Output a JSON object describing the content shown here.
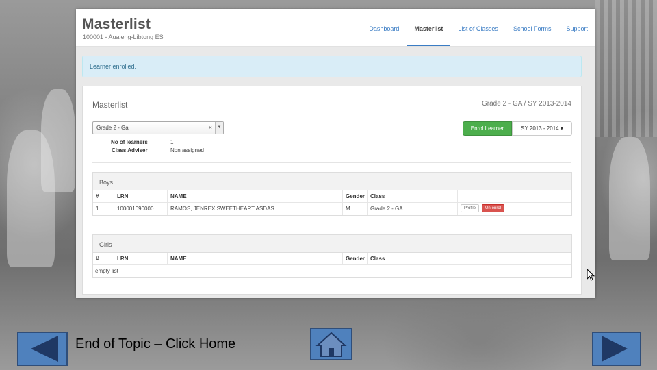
{
  "app": {
    "title": "Masterlist",
    "school": "100001 - Aualeng-Libtong ES"
  },
  "nav": [
    {
      "label": "Dashboard",
      "active": false
    },
    {
      "label": "Masterlist",
      "active": true
    },
    {
      "label": "List of Classes",
      "active": false
    },
    {
      "label": "School Forms",
      "active": false
    },
    {
      "label": "Support",
      "active": false
    }
  ],
  "alert": {
    "text": "Learner enrolled."
  },
  "panel": {
    "title": "Masterlist",
    "context": "Grade 2 - GA / SY 2013-2014",
    "class_select": "Grade 2 - Ga",
    "no_learners_label": "No of learners",
    "no_learners_value": "1",
    "adviser_label": "Class Adviser",
    "adviser_value": "Non assigned",
    "enrol_button": "Enrol Learner",
    "sy_button": "SY 2013 - 2014",
    "sy_caret": "▾"
  },
  "columns": [
    "#",
    "LRN",
    "NAME",
    "Gender",
    "Class"
  ],
  "boys": {
    "heading": "Boys",
    "rows": [
      {
        "num": "1",
        "lrn": "100001090000",
        "name": "RAMOS, JENREX SWEETHEART ASDAS",
        "gender": "M",
        "class": "Grade 2 - GA",
        "profile": "Profile",
        "unenrol": "Un-enrol"
      }
    ]
  },
  "girls": {
    "heading": "Girls",
    "empty": "empty list"
  },
  "footer": {
    "text": "End of Topic – Click Home"
  },
  "colors": {
    "accent": "#3a7cc4",
    "success": "#4cae4c",
    "danger": "#d9534f",
    "nav_button": "#4f81bd"
  }
}
